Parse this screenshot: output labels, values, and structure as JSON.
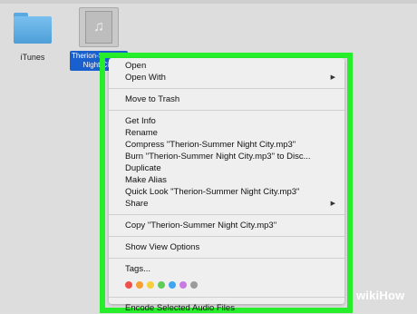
{
  "desktop": {
    "folder": {
      "label": "iTunes",
      "icon": "folder-icon"
    },
    "file": {
      "label_line1": "Therion-Summer",
      "label_line2": "Night City",
      "icon": "audio-file-icon",
      "glyph": "♫"
    }
  },
  "menu": {
    "group1": {
      "open": "Open",
      "open_with": "Open With"
    },
    "group2": {
      "trash": "Move to Trash"
    },
    "group3": {
      "get_info": "Get Info",
      "rename": "Rename",
      "compress": "Compress \"Therion-Summer Night City.mp3\"",
      "burn": "Burn \"Therion-Summer Night City.mp3\" to Disc...",
      "duplicate": "Duplicate",
      "make_alias": "Make Alias",
      "quick_look": "Quick Look \"Therion-Summer Night City.mp3\"",
      "share": "Share"
    },
    "group4": {
      "copy": "Copy \"Therion-Summer Night City.mp3\""
    },
    "group5": {
      "show_view_options": "Show View Options"
    },
    "group6": {
      "tags": "Tags..."
    },
    "tag_colors": [
      "#f0504a",
      "#f6a032",
      "#f5d03b",
      "#5fcc55",
      "#3fa5f0",
      "#c87ae0",
      "#9b9b9b"
    ],
    "group7": {
      "encode": "Encode Selected Audio Files"
    },
    "submenu_arrow": "▶"
  },
  "highlight_color": "#26ee2a",
  "watermark": {
    "text": "wikiHow"
  }
}
